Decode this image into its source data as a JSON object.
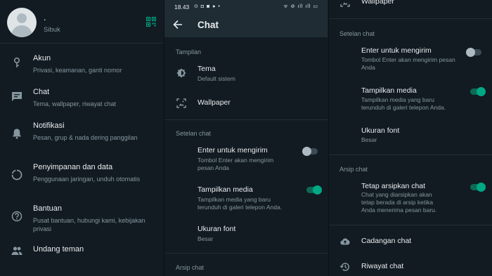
{
  "panel1": {
    "profile": {
      "name": ".",
      "status": "Sibuk",
      "qr_icon": "qr-code-icon"
    },
    "items": [
      {
        "icon": "key-icon",
        "title": "Akun",
        "subtitle": "Privasi, keamanan, ganti nomor"
      },
      {
        "icon": "chat-icon",
        "title": "Chat",
        "subtitle": "Tema, wallpaper, riwayat chat"
      },
      {
        "icon": "bell-icon",
        "title": "Notifikasi",
        "subtitle": "Pesan, grup & nada dering panggilan"
      },
      {
        "icon": "storage-icon",
        "title": "Penyimpanan dan data",
        "subtitle": "Penggunaan jaringan, unduh otomatis"
      },
      {
        "icon": "help-icon",
        "title": "Bantuan",
        "subtitle": "Pusat bantuan, hubungi kami, kebijakan privasi"
      },
      {
        "icon": "people-icon",
        "title": "Undang teman",
        "subtitle": ""
      }
    ]
  },
  "panel2": {
    "statusbar": {
      "time": "18.43",
      "left_icons": "⊙ ◘ ◙ ● •",
      "right_icons": "ᯤ ⊘ ıll ıll ▭"
    },
    "appbar": {
      "title": "Chat",
      "back_icon": "arrow-left-icon"
    },
    "sections": {
      "display": "Tampilan",
      "chat_settings": "Setelan chat",
      "archive": "Arsip chat"
    },
    "theme": {
      "title": "Tema",
      "subtitle": "Default sistem"
    },
    "wallpaper": {
      "title": "Wallpaper"
    },
    "enter_send": {
      "title": "Enter untuk mengirim",
      "subtitle": "Tombol Enter akan mengirim pesan Anda",
      "on": false
    },
    "media_visibility": {
      "title": "Tampilkan media",
      "subtitle": "Tampilkan media yang baru terunduh di galeri telepon Anda.",
      "on": true
    },
    "font_size": {
      "title": "Ukuran font",
      "subtitle": "Besar"
    }
  },
  "panel3": {
    "wallpaper": {
      "title": "Wallpaper"
    },
    "sections": {
      "chat_settings": "Setelan chat",
      "archive": "Arsip chat"
    },
    "enter_send": {
      "title": "Enter untuk mengirim",
      "subtitle": "Tombol Enter akan mengirim pesan Anda",
      "on": false
    },
    "media_visibility": {
      "title": "Tampilkan media",
      "subtitle": "Tampilkan media yang baru terunduh di galeri telepon Anda.",
      "on": true
    },
    "font_size": {
      "title": "Ukuran font",
      "subtitle": "Besar"
    },
    "keep_archived": {
      "title": "Tetap arsipkan chat",
      "subtitle": "Chat yang diarsipkan akan tetap berada di arsip ketika Anda menerima pesan baru.",
      "on": true
    },
    "backup": {
      "title": "Cadangan chat"
    },
    "history": {
      "title": "Riwayat chat"
    }
  },
  "colors": {
    "background": "#121b22",
    "bar": "#1f2c34",
    "accent": "#00a884",
    "secondary_text": "#8696a0"
  }
}
